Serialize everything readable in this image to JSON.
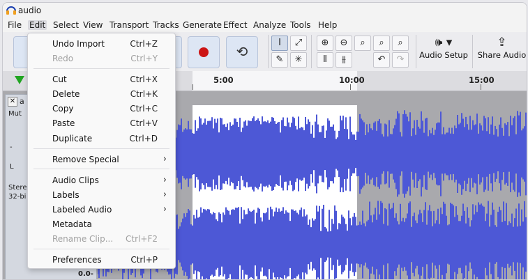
{
  "window": {
    "title": "audio"
  },
  "menubar": [
    "File",
    "Edit",
    "Select",
    "View",
    "Transport",
    "Tracks",
    "Generate",
    "Effect",
    "Analyze",
    "Tools",
    "Help"
  ],
  "toolbar": {
    "audio_setup_label": "Audio Setup",
    "share_audio_label": "Share Audio"
  },
  "timeline": {
    "ticks": [
      "5:00",
      "10:00",
      "15:00"
    ]
  },
  "track": {
    "name": "a",
    "mute": "Mut",
    "dash": "-",
    "pan": "L",
    "info1": "Stere",
    "info2": "32-bi",
    "scale": "0.0-"
  },
  "edit_menu": {
    "items": [
      {
        "label": "Undo Import",
        "shortcut": "Ctrl+Z",
        "disabled": false,
        "submenu": false
      },
      {
        "label": "Redo",
        "shortcut": "Ctrl+Y",
        "disabled": true,
        "submenu": false
      },
      {
        "label": "Cut",
        "shortcut": "Ctrl+X",
        "disabled": false,
        "submenu": false
      },
      {
        "label": "Delete",
        "shortcut": "Ctrl+K",
        "disabled": false,
        "submenu": false
      },
      {
        "label": "Copy",
        "shortcut": "Ctrl+C",
        "disabled": false,
        "submenu": false
      },
      {
        "label": "Paste",
        "shortcut": "Ctrl+V",
        "disabled": false,
        "submenu": false
      },
      {
        "label": "Duplicate",
        "shortcut": "Ctrl+D",
        "disabled": false,
        "submenu": false
      },
      {
        "label": "Remove Special",
        "shortcut": "",
        "disabled": false,
        "submenu": true
      },
      {
        "label": "Audio Clips",
        "shortcut": "",
        "disabled": false,
        "submenu": true
      },
      {
        "label": "Labels",
        "shortcut": "",
        "disabled": false,
        "submenu": true
      },
      {
        "label": "Labeled Audio",
        "shortcut": "",
        "disabled": false,
        "submenu": true
      },
      {
        "label": "Metadata",
        "shortcut": "",
        "disabled": false,
        "submenu": false
      },
      {
        "label": "Rename Clip...",
        "shortcut": "Ctrl+F2",
        "disabled": true,
        "submenu": false
      },
      {
        "label": "Preferences",
        "shortcut": "Ctrl+P",
        "disabled": false,
        "submenu": false
      }
    ]
  },
  "colors": {
    "waveform": "#4d58d6",
    "record": "#cc1515",
    "play": "#22a522",
    "clip_bg": "#a9a9ad",
    "selection_bg": "#ffffff"
  },
  "icons": [
    "audio-app-icon",
    "record-icon",
    "loop-icon",
    "ibeam-tool-icon",
    "envelope-tool-icon",
    "draw-tool-icon",
    "multi-tool-icon",
    "zoom-in-icon",
    "zoom-out-icon",
    "zoom-selection-icon",
    "zoom-fit-icon",
    "zoom-toggle-icon",
    "trim-outside-icon",
    "silence-selection-icon",
    "undo-icon",
    "redo-icon",
    "speaker-icon",
    "share-icon",
    "play-marker-icon",
    "close-icon",
    "chevron-right-icon"
  ]
}
